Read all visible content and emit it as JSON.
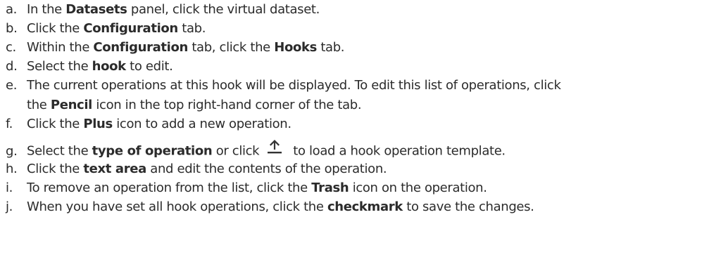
{
  "steps": [
    {
      "marker": "a.",
      "t1": "In the ",
      "b1": "Datasets",
      "t2": " panel, click the virtual dataset."
    },
    {
      "marker": "b.",
      "t1": "Click the ",
      "b1": "Configuration",
      "t2": " tab."
    },
    {
      "marker": "c.",
      "t1": "Within the ",
      "b1": "Configuration",
      "t2": " tab, click the ",
      "b2": "Hooks",
      "t3": " tab."
    },
    {
      "marker": "d.",
      "t1": "Select the ",
      "b1": "hook",
      "t2": " to edit."
    },
    {
      "marker": "e.",
      "t1": "The current operations at this hook will be displayed. To edit this list of operations, click",
      "t2": "the ",
      "b1": "Pencil",
      "t3": " icon in the top right-hand corner of the tab."
    },
    {
      "marker": "f.",
      "t1": "Click the ",
      "b1": "Plus",
      "t2": " icon to add a new operation."
    },
    {
      "marker": "g.",
      "t1": "Select the ",
      "b1": "type of operation",
      "t2": " or click",
      "icon": "upload-icon",
      "t3": "to load a hook operation template."
    },
    {
      "marker": "h.",
      "t1": "Click the ",
      "b1": "text area",
      "t2": " and edit the contents of the operation."
    },
    {
      "marker": "i.",
      "t1": "To remove an operation from the list, click the ",
      "b1": "Trash",
      "t2": " icon on the operation."
    },
    {
      "marker": "j.",
      "t1": "When you have set all hook operations, click the ",
      "b1": "checkmark",
      "t2": " to save the changes."
    }
  ]
}
